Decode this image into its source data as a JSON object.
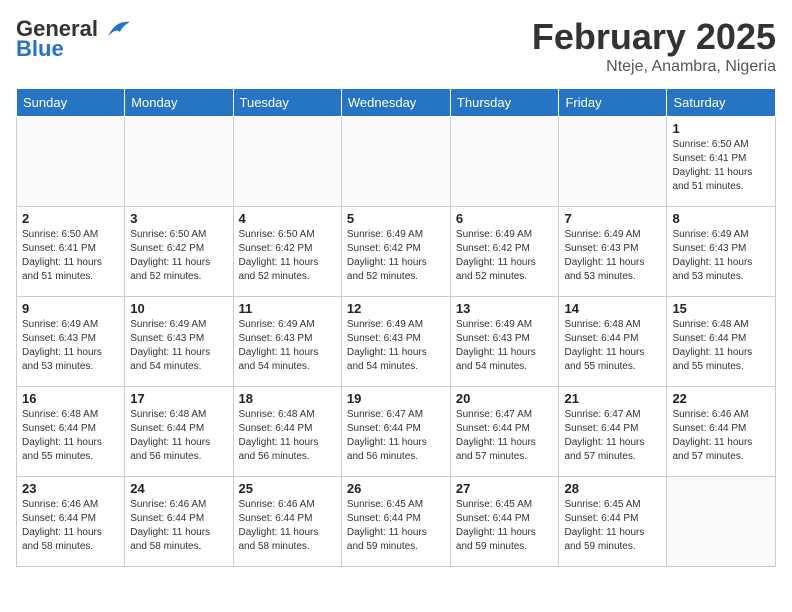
{
  "logo": {
    "general": "General",
    "blue": "Blue"
  },
  "header": {
    "month": "February 2025",
    "location": "Nteje, Anambra, Nigeria"
  },
  "weekdays": [
    "Sunday",
    "Monday",
    "Tuesday",
    "Wednesday",
    "Thursday",
    "Friday",
    "Saturday"
  ],
  "weeks": [
    [
      {
        "day": "",
        "info": ""
      },
      {
        "day": "",
        "info": ""
      },
      {
        "day": "",
        "info": ""
      },
      {
        "day": "",
        "info": ""
      },
      {
        "day": "",
        "info": ""
      },
      {
        "day": "",
        "info": ""
      },
      {
        "day": "1",
        "info": "Sunrise: 6:50 AM\nSunset: 6:41 PM\nDaylight: 11 hours and 51 minutes."
      }
    ],
    [
      {
        "day": "2",
        "info": "Sunrise: 6:50 AM\nSunset: 6:41 PM\nDaylight: 11 hours and 51 minutes."
      },
      {
        "day": "3",
        "info": "Sunrise: 6:50 AM\nSunset: 6:42 PM\nDaylight: 11 hours and 52 minutes."
      },
      {
        "day": "4",
        "info": "Sunrise: 6:50 AM\nSunset: 6:42 PM\nDaylight: 11 hours and 52 minutes."
      },
      {
        "day": "5",
        "info": "Sunrise: 6:49 AM\nSunset: 6:42 PM\nDaylight: 11 hours and 52 minutes."
      },
      {
        "day": "6",
        "info": "Sunrise: 6:49 AM\nSunset: 6:42 PM\nDaylight: 11 hours and 52 minutes."
      },
      {
        "day": "7",
        "info": "Sunrise: 6:49 AM\nSunset: 6:43 PM\nDaylight: 11 hours and 53 minutes."
      },
      {
        "day": "8",
        "info": "Sunrise: 6:49 AM\nSunset: 6:43 PM\nDaylight: 11 hours and 53 minutes."
      }
    ],
    [
      {
        "day": "9",
        "info": "Sunrise: 6:49 AM\nSunset: 6:43 PM\nDaylight: 11 hours and 53 minutes."
      },
      {
        "day": "10",
        "info": "Sunrise: 6:49 AM\nSunset: 6:43 PM\nDaylight: 11 hours and 54 minutes."
      },
      {
        "day": "11",
        "info": "Sunrise: 6:49 AM\nSunset: 6:43 PM\nDaylight: 11 hours and 54 minutes."
      },
      {
        "day": "12",
        "info": "Sunrise: 6:49 AM\nSunset: 6:43 PM\nDaylight: 11 hours and 54 minutes."
      },
      {
        "day": "13",
        "info": "Sunrise: 6:49 AM\nSunset: 6:43 PM\nDaylight: 11 hours and 54 minutes."
      },
      {
        "day": "14",
        "info": "Sunrise: 6:48 AM\nSunset: 6:44 PM\nDaylight: 11 hours and 55 minutes."
      },
      {
        "day": "15",
        "info": "Sunrise: 6:48 AM\nSunset: 6:44 PM\nDaylight: 11 hours and 55 minutes."
      }
    ],
    [
      {
        "day": "16",
        "info": "Sunrise: 6:48 AM\nSunset: 6:44 PM\nDaylight: 11 hours and 55 minutes."
      },
      {
        "day": "17",
        "info": "Sunrise: 6:48 AM\nSunset: 6:44 PM\nDaylight: 11 hours and 56 minutes."
      },
      {
        "day": "18",
        "info": "Sunrise: 6:48 AM\nSunset: 6:44 PM\nDaylight: 11 hours and 56 minutes."
      },
      {
        "day": "19",
        "info": "Sunrise: 6:47 AM\nSunset: 6:44 PM\nDaylight: 11 hours and 56 minutes."
      },
      {
        "day": "20",
        "info": "Sunrise: 6:47 AM\nSunset: 6:44 PM\nDaylight: 11 hours and 57 minutes."
      },
      {
        "day": "21",
        "info": "Sunrise: 6:47 AM\nSunset: 6:44 PM\nDaylight: 11 hours and 57 minutes."
      },
      {
        "day": "22",
        "info": "Sunrise: 6:46 AM\nSunset: 6:44 PM\nDaylight: 11 hours and 57 minutes."
      }
    ],
    [
      {
        "day": "23",
        "info": "Sunrise: 6:46 AM\nSunset: 6:44 PM\nDaylight: 11 hours and 58 minutes."
      },
      {
        "day": "24",
        "info": "Sunrise: 6:46 AM\nSunset: 6:44 PM\nDaylight: 11 hours and 58 minutes."
      },
      {
        "day": "25",
        "info": "Sunrise: 6:46 AM\nSunset: 6:44 PM\nDaylight: 11 hours and 58 minutes."
      },
      {
        "day": "26",
        "info": "Sunrise: 6:45 AM\nSunset: 6:44 PM\nDaylight: 11 hours and 59 minutes."
      },
      {
        "day": "27",
        "info": "Sunrise: 6:45 AM\nSunset: 6:44 PM\nDaylight: 11 hours and 59 minutes."
      },
      {
        "day": "28",
        "info": "Sunrise: 6:45 AM\nSunset: 6:44 PM\nDaylight: 11 hours and 59 minutes."
      },
      {
        "day": "",
        "info": ""
      }
    ]
  ]
}
